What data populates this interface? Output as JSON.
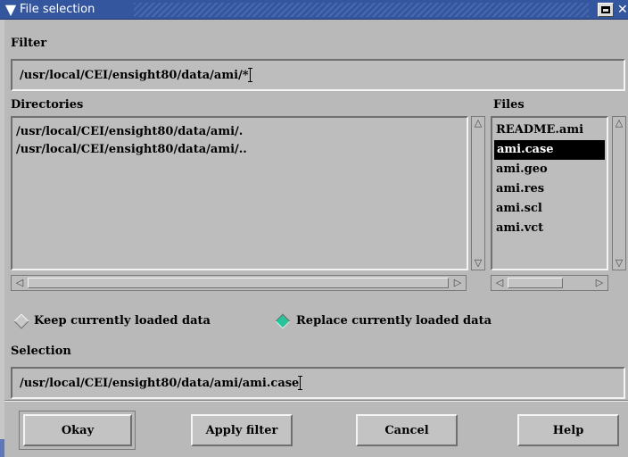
{
  "window": {
    "title": "File selection",
    "menu_icon": "chevron-down-icon",
    "close_icon": "close-icon"
  },
  "filter": {
    "label": "Filter",
    "value": "/usr/local/CEI/ensight80/data/ami/*"
  },
  "directories": {
    "label": "Directories",
    "items": [
      "/usr/local/CEI/ensight80/data/ami/.",
      "/usr/local/CEI/ensight80/data/ami/.."
    ]
  },
  "files": {
    "label": "Files",
    "items": [
      "README.ami",
      "ami.case",
      "ami.geo",
      "ami.res",
      "ami.scl",
      "ami.vct"
    ],
    "selected_index": 1
  },
  "load_mode": {
    "options": [
      "Keep currently loaded data",
      "Replace currently loaded data"
    ],
    "selected_index": 1,
    "selected_color": "#25c49a"
  },
  "selection": {
    "label": "Selection",
    "value": "/usr/local/CEI/ensight80/data/ami/ami.case"
  },
  "buttons": {
    "okay": "Okay",
    "apply_filter": "Apply filter",
    "cancel": "Cancel",
    "help": "Help"
  },
  "colors": {
    "titlebar": "#34569e",
    "background": "#b9b9b9"
  }
}
